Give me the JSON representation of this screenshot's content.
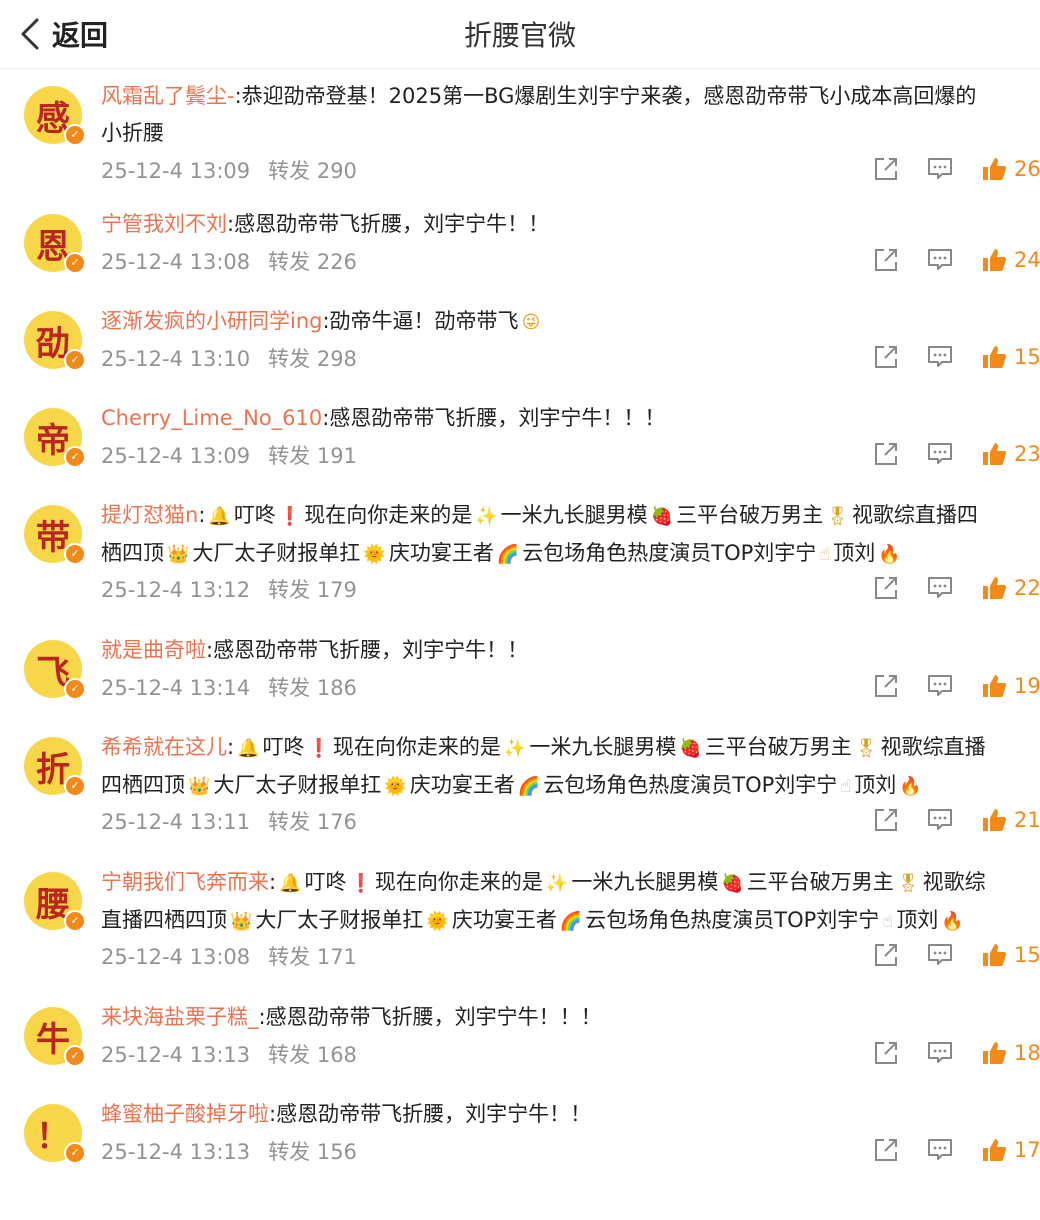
{
  "header": {
    "back_label": "返回",
    "title": "折腰官微"
  },
  "repost_label": "转发",
  "comments": [
    {
      "avatar_char": "感",
      "user": "风霜乱了鬓尘-",
      "text_lines": [
        [
          ":恭迎劭帝登基！2025第一BG爆剧生刘宇宁来袭，感恩劭帝带飞小成本高回爆的"
        ],
        [
          "小折腰"
        ]
      ],
      "time": "25-12-4 13:09",
      "reposts": "290",
      "likes": "26"
    },
    {
      "avatar_char": "恩",
      "user": "宁管我刘不刘",
      "text_lines": [
        [
          ":感恩劭帝带飞折腰，刘宇宁牛！！"
        ]
      ],
      "time": "25-12-4 13:08",
      "reposts": "226",
      "likes": "24"
    },
    {
      "avatar_char": "劭",
      "user": "逐渐发疯的小研同学ing",
      "text_lines": [
        [
          ":劭帝牛逼！劭帝带飞",
          {
            "e": "face-icon",
            "g": "😜",
            "c": "e-face"
          }
        ]
      ],
      "time": "25-12-4 13:10",
      "reposts": "298",
      "likes": "15"
    },
    {
      "avatar_char": "帝",
      "user": "Cherry_Lime_No_610",
      "text_lines": [
        [
          ":感恩劭帝带飞折腰，刘宇宁牛！！！"
        ]
      ],
      "time": "25-12-4 13:09",
      "reposts": "191",
      "likes": "23"
    },
    {
      "avatar_char": "带",
      "user": "提灯怼猫n",
      "text_lines": [
        [
          ":",
          {
            "e": "bell-icon",
            "g": "🔔",
            "c": "e-bell"
          },
          "叮咚",
          {
            "e": "exclamation-icon",
            "g": "❗",
            "c": "e-excl"
          },
          "现在向你走来的是",
          {
            "e": "sparkles-icon",
            "g": "✨",
            "c": "e-spark"
          },
          "一米九长腿男模",
          {
            "e": "strawberry-icon",
            "g": "🍓",
            "c": "e-straw"
          },
          "三平台破万男主",
          {
            "e": "medal-icon",
            "g": "🎖",
            "c": "e-medal"
          },
          "视歌综直播四"
        ],
        [
          "栖四顶",
          {
            "e": "crown-icon",
            "g": "👑",
            "c": "e-crown"
          },
          "大厂太子财报单扛",
          {
            "e": "sun-icon",
            "g": "🌞",
            "c": "e-sun"
          },
          "庆功宴王者",
          {
            "e": "rainbow-icon",
            "g": "🌈",
            "c": "e-rainbow"
          },
          "云包场角色热度演员TOP刘宇宁",
          {
            "e": "pointing-up-icon",
            "g": "☝",
            "c": "e-hand"
          },
          "顶刘",
          {
            "e": "fire-icon",
            "g": "🔥",
            "c": "e-fire"
          }
        ]
      ],
      "time": "25-12-4 13:12",
      "reposts": "179",
      "likes": "22"
    },
    {
      "avatar_char": "飞",
      "user": "就是曲奇啦",
      "text_lines": [
        [
          ":感恩劭帝带飞折腰，刘宇宁牛！！"
        ]
      ],
      "time": "25-12-4 13:14",
      "reposts": "186",
      "likes": "19"
    },
    {
      "avatar_char": "折",
      "user": "希希就在这儿",
      "text_lines": [
        [
          ":",
          {
            "e": "bell-icon",
            "g": "🔔",
            "c": "e-bell"
          },
          "叮咚",
          {
            "e": "exclamation-icon",
            "g": "❗",
            "c": "e-excl"
          },
          "现在向你走来的是",
          {
            "e": "sparkles-icon",
            "g": "✨",
            "c": "e-spark"
          },
          "一米九长腿男模",
          {
            "e": "strawberry-icon",
            "g": "🍓",
            "c": "e-straw"
          },
          "三平台破万男主",
          {
            "e": "medal-icon",
            "g": "🎖",
            "c": "e-medal"
          },
          "视歌综直播"
        ],
        [
          "四栖四顶",
          {
            "e": "crown-icon",
            "g": "👑",
            "c": "e-crown"
          },
          "大厂太子财报单扛",
          {
            "e": "sun-icon",
            "g": "🌞",
            "c": "e-sun"
          },
          "庆功宴王者",
          {
            "e": "rainbow-icon",
            "g": "🌈",
            "c": "e-rainbow"
          },
          "云包场角色热度演员TOP刘宇宁",
          {
            "e": "pointing-up-icon",
            "g": "☝",
            "c": "e-hand"
          },
          "顶刘",
          {
            "e": "fire-icon",
            "g": "🔥",
            "c": "e-fire"
          }
        ]
      ],
      "time": "25-12-4 13:11",
      "reposts": "176",
      "likes": "21"
    },
    {
      "avatar_char": "腰",
      "user": "宁朝我们飞奔而来",
      "text_lines": [
        [
          ":",
          {
            "e": "bell-icon",
            "g": "🔔",
            "c": "e-bell"
          },
          "叮咚",
          {
            "e": "exclamation-icon",
            "g": "❗",
            "c": "e-excl"
          },
          "现在向你走来的是",
          {
            "e": "sparkles-icon",
            "g": "✨",
            "c": "e-spark"
          },
          "一米九长腿男模",
          {
            "e": "strawberry-icon",
            "g": "🍓",
            "c": "e-straw"
          },
          "三平台破万男主",
          {
            "e": "medal-icon",
            "g": "🎖",
            "c": "e-medal"
          },
          "视歌综"
        ],
        [
          "直播四栖四顶",
          {
            "e": "crown-icon",
            "g": "👑",
            "c": "e-crown"
          },
          "大厂太子财报单扛",
          {
            "e": "sun-icon",
            "g": "🌞",
            "c": "e-sun"
          },
          "庆功宴王者",
          {
            "e": "rainbow-icon",
            "g": "🌈",
            "c": "e-rainbow"
          },
          "云包场角色热度演员TOP刘宇宁",
          {
            "e": "pointing-up-icon",
            "g": "☝",
            "c": "e-hand"
          },
          "顶刘",
          {
            "e": "fire-icon",
            "g": "🔥",
            "c": "e-fire"
          }
        ]
      ],
      "time": "25-12-4 13:08",
      "reposts": "171",
      "likes": "15"
    },
    {
      "avatar_char": "牛",
      "user": "来块海盐栗子糕_",
      "text_lines": [
        [
          ":感恩劭帝带飞折腰，刘宇宁牛！！！"
        ]
      ],
      "time": "25-12-4 13:13",
      "reposts": "168",
      "likes": "18"
    },
    {
      "avatar_char": "！",
      "user": "蜂蜜柚子酸掉牙啦",
      "text_lines": [
        [
          ":感恩劭帝带飞折腰，刘宇宁牛！！"
        ]
      ],
      "time": "25-12-4 13:13",
      "reposts": "156",
      "likes": "17"
    }
  ]
}
